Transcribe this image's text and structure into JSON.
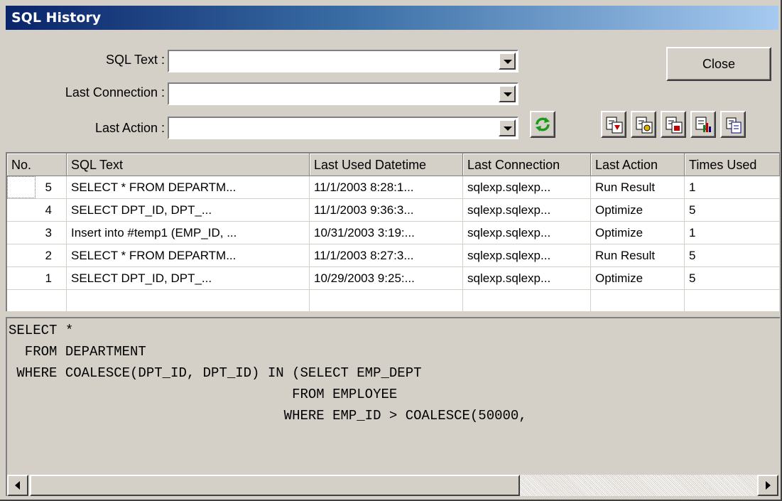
{
  "window": {
    "title": "SQL History"
  },
  "filters": {
    "sql_text_label": "SQL Text :",
    "sql_text_value": "",
    "last_connection_label": "Last Connection :",
    "last_connection_value": "",
    "last_action_label": "Last Action :",
    "last_action_value": ""
  },
  "buttons": {
    "close_label": "Close"
  },
  "toolbar_icons": [
    "refresh-icon",
    "copy-to-editor-icon",
    "send-to-optimizer-icon",
    "export-icon",
    "delete-icon",
    "copy-icon"
  ],
  "grid": {
    "columns": [
      "No.",
      "SQL Text",
      "Last Used Datetime",
      "Last Connection",
      "Last Action",
      "Times Used"
    ],
    "rows": [
      [
        "5",
        "SELECT *    FROM DEPARTM...",
        "11/1/2003 8:28:1...",
        "sqlexp.sqlexp...",
        "Run Result",
        "1"
      ],
      [
        "4",
        "SELECT DPT_ID,         DPT_...",
        "11/1/2003 9:36:3...",
        "sqlexp.sqlexp...",
        "Optimize",
        "5"
      ],
      [
        "3",
        "Insert into #temp1 (EMP_ID,    ...",
        "10/31/2003 3:19:...",
        "sqlexp.sqlexp...",
        "Optimize",
        "1"
      ],
      [
        "2",
        "SELECT *    FROM DEPARTM...",
        "11/1/2003 8:27:3...",
        "sqlexp.sqlexp...",
        "Run Result",
        "5"
      ],
      [
        "1",
        "SELECT DPT_ID,         DPT_...",
        "10/29/2003 9:25:...",
        "sqlexp.sqlexp...",
        "Optimize",
        "5"
      ]
    ]
  },
  "sql_preview": "SELECT *\n  FROM DEPARTMENT\n WHERE COALESCE(DPT_ID, DPT_ID) IN (SELECT EMP_DEPT\n                                   FROM EMPLOYEE\n                                  WHERE EMP_ID > COALESCE(50000,",
  "colors": {
    "title_start": "#0a246a",
    "title_end": "#a6caf0",
    "face": "#d4d0c8"
  }
}
